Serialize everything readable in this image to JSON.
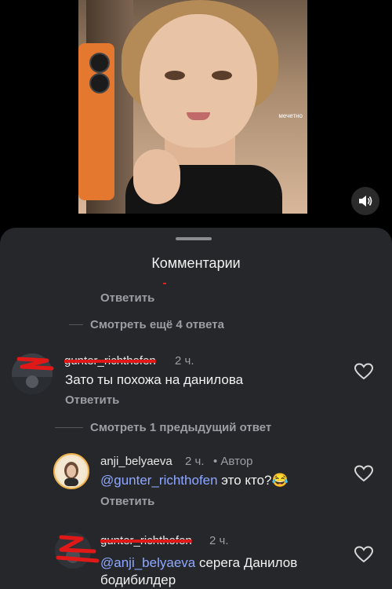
{
  "video": {
    "watermark": "мечетно",
    "sound_icon": "speaker-icon"
  },
  "comments_panel": {
    "title": "Комментарии",
    "top_reply_label": "Ответить",
    "view_more_label": "Смотреть ещё 4 ответа",
    "comments": [
      {
        "username": "gunter_richthofen",
        "time": "2 ч.",
        "text": "Зато ты похожа на данилова",
        "reply_label": "Ответить"
      }
    ],
    "view_previous_label": "Смотреть 1 предыдущий ответ",
    "replies": [
      {
        "username": "anji_belyaeva",
        "time": "2 ч.",
        "author_tag": "• Автор",
        "mention": "@gunter_richthofen",
        "text": " это кто?",
        "emoji": "😂",
        "reply_label": "Ответить"
      },
      {
        "username": "gunter_richthofen",
        "time": "2 ч.",
        "mention": "@anji_belyaeva",
        "text": " серега Данилов",
        "text_line2": "бодибилдер"
      }
    ]
  },
  "colors": {
    "sheet_bg": "#25272b",
    "muted_text": "#9c9ea3",
    "mention": "#8fa8ff",
    "scribble_red": "#e01818"
  }
}
